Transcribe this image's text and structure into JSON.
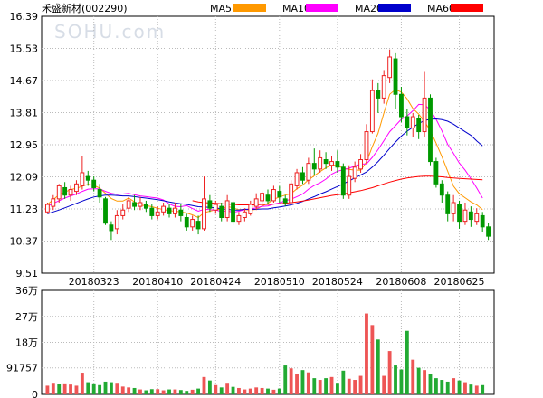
{
  "header": {
    "stock_title": "禾盛新材(002290)",
    "watermark": "SOHU.com"
  },
  "chart_data": [
    {
      "type": "candlestick",
      "title": "禾盛新材(002290)",
      "y_ticks": [
        "16.39",
        "15.53",
        "14.67",
        "13.81",
        "12.95",
        "12.09",
        "11.23",
        "10.37",
        "9.51"
      ],
      "ylim": [
        9.51,
        16.39
      ],
      "x_tick_labels": [
        {
          "label": "20180323",
          "index": 8
        },
        {
          "label": "20180410",
          "index": 19
        },
        {
          "label": "20180424",
          "index": 29
        },
        {
          "label": "20180510",
          "index": 40
        },
        {
          "label": "20180524",
          "index": 50
        },
        {
          "label": "20180608",
          "index": 61
        },
        {
          "label": "20180625",
          "index": 71
        }
      ],
      "grid": true,
      "legend": [
        {
          "name": "MA5",
          "color": "#ff9900"
        },
        {
          "name": "MA10",
          "color": "#ff00ff"
        },
        {
          "name": "MA20",
          "color": "#0000cc"
        },
        {
          "name": "MA60",
          "color": "#ff0000"
        }
      ],
      "up_color": "#ee2222",
      "down_color": "#009900",
      "candles": [
        [
          11.15,
          11.35,
          11.1,
          11.4
        ],
        [
          11.3,
          11.5,
          11.2,
          11.6
        ],
        [
          11.5,
          11.85,
          11.4,
          11.9
        ],
        [
          11.8,
          11.6,
          11.5,
          11.95
        ],
        [
          11.6,
          11.75,
          11.45,
          11.85
        ],
        [
          11.7,
          11.9,
          11.6,
          12.0
        ],
        [
          11.85,
          12.2,
          11.75,
          12.65
        ],
        [
          12.1,
          12.0,
          11.85,
          12.25
        ],
        [
          12.0,
          11.8,
          11.7,
          12.1
        ],
        [
          11.75,
          11.55,
          11.4,
          11.9
        ],
        [
          11.5,
          10.85,
          10.8,
          11.55
        ],
        [
          10.8,
          10.65,
          10.4,
          10.9
        ],
        [
          10.7,
          11.05,
          10.55,
          11.2
        ],
        [
          11.05,
          11.2,
          10.95,
          11.35
        ],
        [
          11.25,
          11.45,
          11.15,
          11.55
        ],
        [
          11.4,
          11.3,
          11.2,
          11.6
        ],
        [
          11.3,
          11.4,
          11.2,
          11.55
        ],
        [
          11.35,
          11.25,
          11.15,
          11.45
        ],
        [
          11.25,
          11.05,
          10.95,
          11.35
        ],
        [
          11.05,
          11.15,
          10.95,
          11.3
        ],
        [
          11.15,
          11.3,
          11.05,
          11.4
        ],
        [
          11.25,
          11.1,
          11.0,
          11.35
        ],
        [
          11.1,
          11.25,
          11.0,
          11.4
        ],
        [
          11.2,
          11.05,
          10.9,
          11.35
        ],
        [
          11.0,
          10.75,
          10.65,
          11.1
        ],
        [
          10.75,
          10.95,
          10.65,
          11.05
        ],
        [
          10.9,
          10.7,
          10.55,
          11.05
        ],
        [
          10.7,
          11.5,
          10.65,
          12.1
        ],
        [
          11.45,
          11.25,
          11.15,
          11.6
        ],
        [
          11.2,
          11.35,
          11.1,
          11.45
        ],
        [
          11.3,
          11.0,
          10.9,
          11.4
        ],
        [
          11.0,
          11.45,
          10.9,
          11.6
        ],
        [
          11.4,
          10.9,
          10.8,
          11.45
        ],
        [
          10.9,
          11.05,
          10.8,
          11.15
        ],
        [
          11.0,
          11.15,
          10.9,
          11.25
        ],
        [
          11.1,
          11.35,
          11.05,
          11.45
        ],
        [
          11.3,
          11.5,
          11.2,
          11.65
        ],
        [
          11.45,
          11.65,
          11.35,
          11.7
        ],
        [
          11.6,
          11.45,
          11.35,
          11.75
        ],
        [
          11.45,
          11.75,
          11.4,
          11.85
        ],
        [
          11.7,
          11.55,
          11.4,
          11.85
        ],
        [
          11.5,
          11.4,
          11.3,
          11.6
        ],
        [
          11.4,
          11.9,
          11.35,
          12.0
        ],
        [
          11.85,
          12.2,
          11.75,
          12.3
        ],
        [
          12.2,
          12.0,
          11.9,
          12.35
        ],
        [
          12.0,
          12.45,
          11.9,
          12.6
        ],
        [
          12.45,
          12.3,
          12.15,
          12.85
        ],
        [
          12.3,
          12.6,
          12.2,
          12.8
        ],
        [
          12.55,
          12.45,
          12.3,
          12.75
        ],
        [
          12.4,
          12.5,
          12.25,
          12.65
        ],
        [
          12.5,
          12.35,
          12.2,
          12.8
        ],
        [
          12.35,
          11.6,
          11.5,
          12.45
        ],
        [
          11.6,
          12.1,
          11.5,
          12.4
        ],
        [
          12.05,
          12.35,
          11.95,
          12.5
        ],
        [
          12.3,
          12.55,
          12.2,
          12.7
        ],
        [
          12.55,
          13.3,
          12.45,
          13.5
        ],
        [
          13.3,
          14.4,
          13.25,
          14.7
        ],
        [
          14.4,
          14.2,
          13.8,
          14.6
        ],
        [
          14.2,
          14.8,
          14.05,
          14.95
        ],
        [
          14.75,
          15.3,
          14.6,
          15.5
        ],
        [
          15.25,
          14.3,
          13.9,
          15.4
        ],
        [
          14.3,
          13.7,
          13.55,
          14.5
        ],
        [
          13.7,
          13.4,
          13.2,
          13.9
        ],
        [
          13.4,
          13.7,
          13.15,
          13.8
        ],
        [
          13.65,
          13.3,
          13.1,
          13.75
        ],
        [
          13.3,
          14.2,
          13.15,
          14.9
        ],
        [
          14.2,
          12.5,
          12.4,
          14.3
        ],
        [
          12.5,
          11.9,
          11.8,
          12.6
        ],
        [
          11.9,
          11.6,
          11.4,
          12.0
        ],
        [
          11.6,
          11.1,
          10.9,
          11.7
        ],
        [
          11.1,
          11.4,
          10.9,
          11.6
        ],
        [
          11.35,
          10.9,
          10.7,
          11.45
        ],
        [
          10.9,
          11.2,
          10.8,
          11.4
        ],
        [
          11.15,
          10.95,
          10.75,
          11.3
        ],
        [
          10.9,
          11.1,
          10.8,
          11.25
        ],
        [
          11.05,
          10.75,
          10.6,
          11.15
        ],
        [
          10.75,
          10.5,
          10.4,
          10.85
        ]
      ],
      "ma_lines": {
        "MA5": [
          11.35,
          11.48,
          11.61,
          11.68,
          11.75,
          11.78,
          11.84,
          11.89,
          11.86,
          11.79,
          11.65,
          11.51,
          11.44,
          11.44,
          11.52,
          11.42,
          11.33,
          11.32,
          11.29,
          11.25,
          11.21,
          11.19,
          11.17,
          11.15,
          11.12,
          11.07,
          11.0,
          11.13,
          11.17,
          11.21,
          11.22,
          11.3,
          11.26,
          11.21,
          11.21,
          11.2,
          11.22,
          11.31,
          11.38,
          11.49,
          11.55,
          11.6,
          11.64,
          11.77,
          11.87,
          12.01,
          12.12,
          12.23,
          12.33,
          12.41,
          12.39,
          12.32,
          12.29,
          12.27,
          12.27,
          12.49,
          12.9,
          13.26,
          13.8,
          14.3,
          14.43,
          14.36,
          14.18,
          13.92,
          13.77,
          13.57,
          13.33,
          12.99,
          12.63,
          12.24,
          11.84,
          11.64,
          11.53,
          11.42,
          11.34,
          11.21
        ],
        "MA10": [
          11.3,
          11.38,
          11.45,
          11.52,
          11.58,
          11.63,
          11.7,
          11.76,
          11.77,
          11.77,
          11.7,
          11.65,
          11.62,
          11.63,
          11.65,
          11.61,
          11.58,
          11.56,
          11.54,
          11.52,
          11.47,
          11.36,
          11.3,
          11.29,
          11.32,
          11.24,
          11.17,
          11.22,
          11.21,
          11.2,
          11.16,
          11.18,
          11.14,
          11.17,
          11.21,
          11.23,
          11.26,
          11.3,
          11.31,
          11.36,
          11.39,
          11.45,
          11.49,
          11.56,
          11.63,
          11.76,
          11.86,
          11.93,
          12.03,
          12.16,
          12.24,
          12.28,
          12.32,
          12.38,
          12.43,
          12.44,
          12.61,
          12.82,
          13.06,
          13.3,
          13.46,
          13.63,
          13.72,
          13.86,
          14.03,
          14.02,
          13.88,
          13.63,
          13.32,
          12.96,
          12.72,
          12.46,
          12.27,
          12.04,
          11.79,
          11.52
        ],
        "MA20": [
          11.1,
          11.15,
          11.2,
          11.26,
          11.32,
          11.38,
          11.44,
          11.5,
          11.55,
          11.58,
          11.6,
          11.6,
          11.59,
          11.58,
          11.58,
          11.56,
          11.54,
          11.52,
          11.5,
          11.48,
          11.45,
          11.42,
          11.39,
          11.37,
          11.35,
          11.32,
          11.29,
          11.28,
          11.27,
          11.26,
          11.23,
          11.22,
          11.2,
          11.2,
          11.22,
          11.22,
          11.22,
          11.23,
          11.23,
          11.26,
          11.28,
          11.31,
          11.34,
          11.38,
          11.43,
          11.5,
          11.56,
          11.63,
          11.69,
          11.76,
          11.83,
          11.9,
          11.98,
          12.06,
          12.14,
          12.22,
          12.35,
          12.5,
          12.67,
          12.85,
          13.02,
          13.18,
          13.31,
          13.42,
          13.52,
          13.6,
          13.63,
          13.64,
          13.62,
          13.58,
          13.5,
          13.4,
          13.3,
          13.2,
          13.05,
          12.92
        ],
        "MA60": [
          null,
          null,
          null,
          null,
          null,
          null,
          null,
          null,
          null,
          null,
          null,
          null,
          null,
          null,
          null,
          null,
          null,
          null,
          null,
          null,
          null,
          null,
          null,
          null,
          null,
          11.45,
          11.42,
          11.4,
          11.39,
          11.38,
          11.37,
          11.36,
          11.35,
          11.34,
          11.34,
          11.34,
          11.34,
          11.35,
          11.35,
          11.36,
          11.37,
          11.38,
          11.4,
          11.42,
          11.44,
          11.47,
          11.5,
          11.53,
          11.56,
          11.59,
          11.61,
          11.63,
          11.66,
          11.69,
          11.72,
          11.76,
          11.8,
          11.85,
          11.9,
          11.95,
          11.99,
          12.03,
          12.06,
          12.08,
          12.1,
          12.11,
          12.11,
          12.1,
          12.09,
          12.07,
          12.06,
          12.05,
          12.04,
          12.03,
          12.02,
          12.01
        ]
      }
    },
    {
      "type": "bar",
      "title": "",
      "y_ticks": [
        "36万",
        "27万",
        "18万",
        "91757",
        "0"
      ],
      "ylim": [
        0,
        360000
      ],
      "values": [
        30000,
        40000,
        35000,
        38000,
        34000,
        30000,
        75000,
        42000,
        38000,
        32000,
        44000,
        42000,
        40000,
        27000,
        24000,
        22000,
        17000,
        14000,
        18000,
        18000,
        14000,
        17000,
        17000,
        15000,
        12000,
        16000,
        20000,
        60000,
        48000,
        32000,
        24000,
        40000,
        26000,
        22000,
        17000,
        20000,
        24000,
        22000,
        20000,
        16000,
        20000,
        100000,
        90000,
        70000,
        84000,
        76000,
        56000,
        50000,
        56000,
        60000,
        40000,
        82000,
        54000,
        50000,
        64000,
        280000,
        240000,
        190000,
        64000,
        150000,
        100000,
        86000,
        220000,
        120000,
        92000,
        84000,
        70000,
        56000,
        50000,
        44000,
        56000,
        48000,
        42000,
        34000,
        30000,
        32000
      ],
      "colors": [
        "up",
        "up",
        "down",
        "up",
        "up",
        "up",
        "up",
        "down",
        "down",
        "down",
        "down",
        "down",
        "up",
        "up",
        "up",
        "down",
        "up",
        "down",
        "down",
        "up",
        "up",
        "down",
        "up",
        "down",
        "down",
        "up",
        "down",
        "up",
        "down",
        "up",
        "down",
        "up",
        "down",
        "up",
        "up",
        "up",
        "up",
        "up",
        "down",
        "up",
        "down",
        "down",
        "up",
        "up",
        "down",
        "up",
        "down",
        "up",
        "down",
        "up",
        "down",
        "down",
        "up",
        "up",
        "up",
        "up",
        "up",
        "down",
        "up",
        "up",
        "down",
        "down",
        "down",
        "up",
        "down",
        "up",
        "down",
        "down",
        "down",
        "down",
        "up",
        "down",
        "up",
        "down",
        "up",
        "down"
      ],
      "up_color": "#ee5555",
      "down_color": "#22aa33"
    }
  ]
}
